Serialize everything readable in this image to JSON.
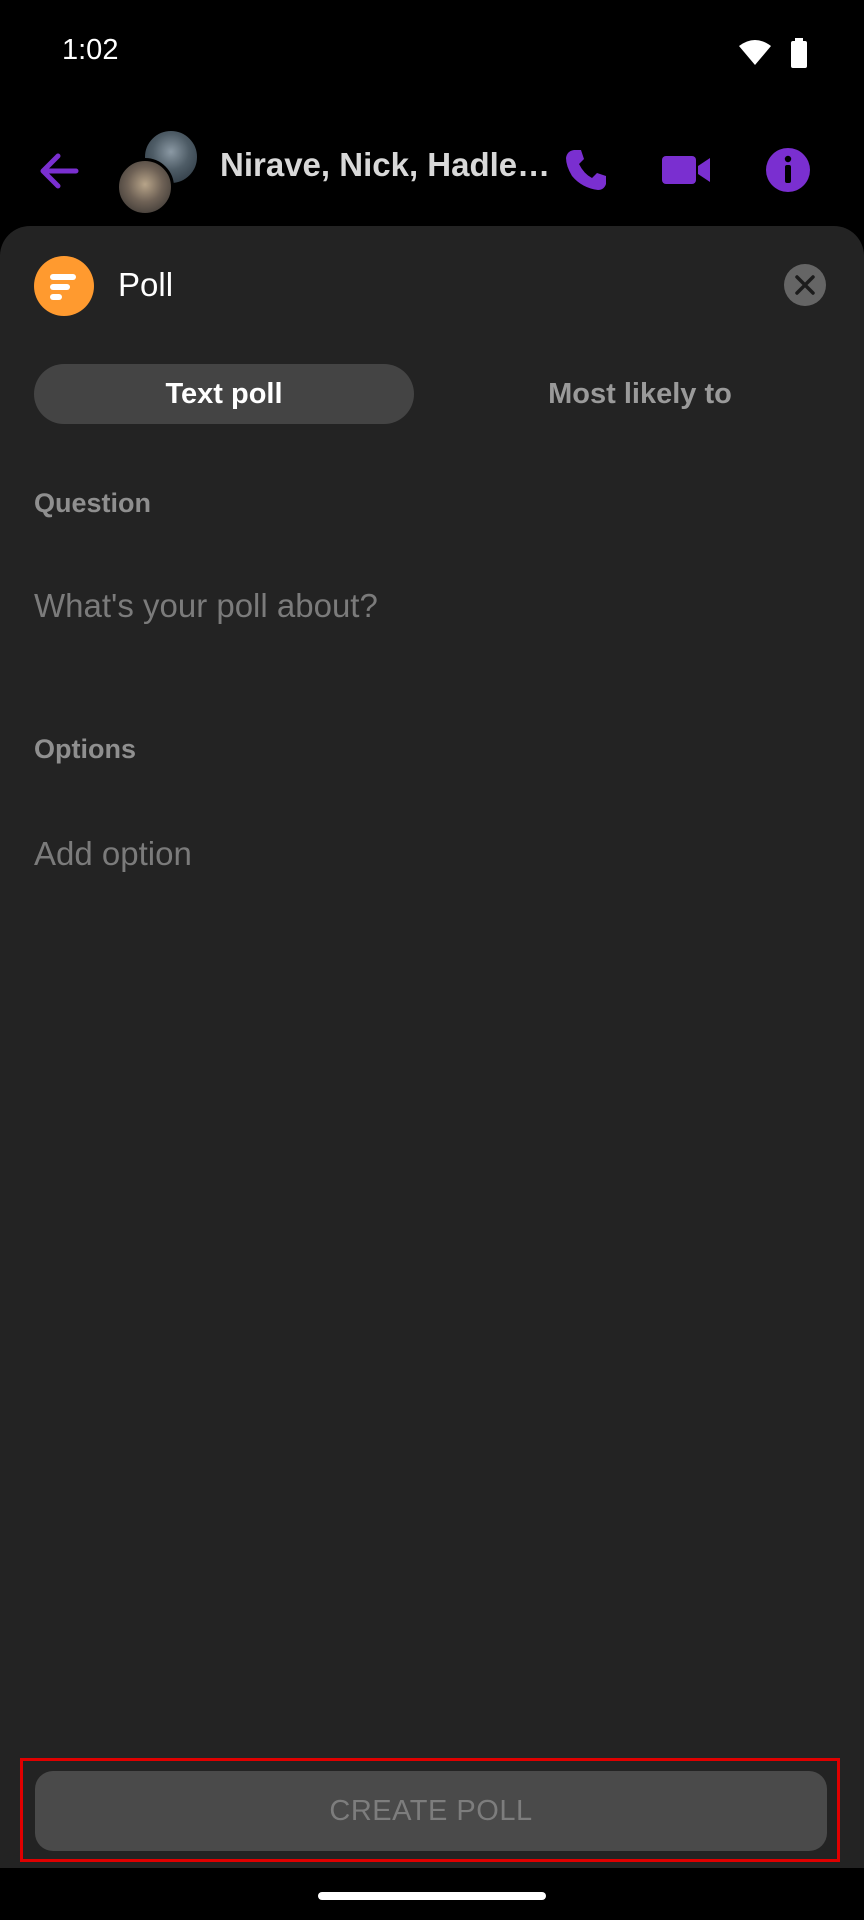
{
  "status_bar": {
    "time": "1:02"
  },
  "header": {
    "title": "Nirave, Nick, Hadle…",
    "accent_color": "#7a2fd0",
    "icons": [
      "back-arrow-icon",
      "phone-icon",
      "video-camera-icon",
      "info-icon"
    ]
  },
  "sheet": {
    "title": "Poll",
    "icon_color": "#ff9a2f",
    "tabs": [
      {
        "label": "Text poll",
        "selected": true
      },
      {
        "label": "Most likely to",
        "selected": false
      }
    ],
    "question": {
      "label": "Question",
      "placeholder": "What's your poll about?",
      "value": ""
    },
    "options": {
      "label": "Options",
      "placeholder": "Add option",
      "value": ""
    },
    "create_button": {
      "label": "CREATE POLL",
      "enabled": false
    }
  }
}
